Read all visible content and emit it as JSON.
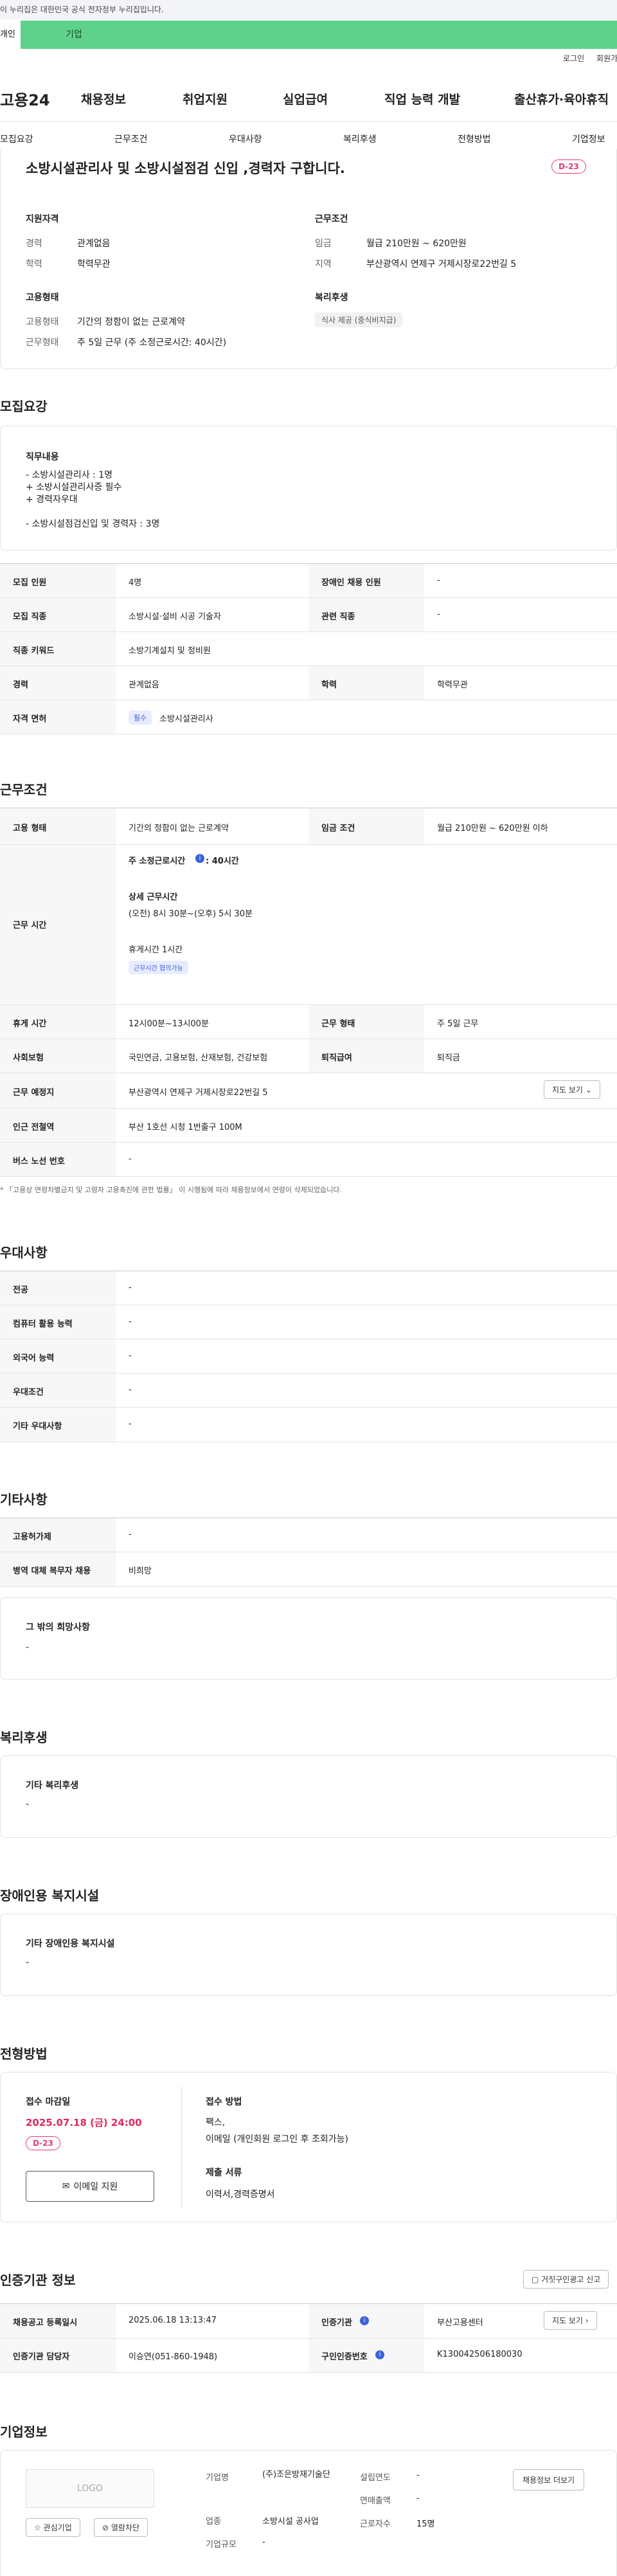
{
  "gov_banner": "이 누리집은 대한민국 공식 전자정부 누리집입니다.",
  "user_tabs": {
    "person": "개인",
    "corp": "기업"
  },
  "util": {
    "login": "로그인",
    "join": "회원가입"
  },
  "gnb": {
    "logo": "고용24",
    "menus": [
      "채용정보",
      "취업지원",
      "실업급여",
      "직업 능력 개발",
      "출산휴가·육아휴직"
    ]
  },
  "snb": [
    "모집요강",
    "근무조건",
    "우대사항",
    "복리후생",
    "전형방법",
    "기업정보"
  ],
  "summary": {
    "title": "소방시설관리사 및 소방시설점검 신입 ,경력자 구합니다.",
    "dday": "D-23",
    "qual_title": "지원자격",
    "qual": [
      {
        "k": "경력",
        "v": "관계없음"
      },
      {
        "k": "학력",
        "v": "학력무관"
      }
    ],
    "cond_title": "근무조건",
    "cond": [
      {
        "k": "임금",
        "v": "월급 210만원 ~ 620만원"
      },
      {
        "k": "지역",
        "v": "부산광역시 연제구 거제시장로22번길 5"
      }
    ],
    "emp_title": "고용형태",
    "emp": [
      {
        "k": "고용형태",
        "v": "기간의 정함이 없는 근로계약"
      },
      {
        "k": "근무형태",
        "v": "주 5일 근무 (주 소정근로시간: 40시간)"
      }
    ],
    "welfare_title": "복리후생",
    "welfare_chip": "식사 제공 (중식비지급)"
  },
  "recruit": {
    "title": "모집요강",
    "duty_title": "직무내용",
    "duty_lines": [
      "- 소방시설관리사 : 1명",
      "+ 소방시설관리사증 필수",
      "+ 경력자우대",
      "",
      "- 소방시설점검신입 및 경력자 : 3명"
    ],
    "rows": [
      {
        "k1": "모집 인원",
        "v1": "4명",
        "k2": "장애인 채용 인원",
        "v2": "-"
      },
      {
        "k1": "모집 직종",
        "v1": "소방시설·설비 시공 기술자",
        "k2": "관련 직종",
        "v2": "-"
      },
      {
        "k1": "직종 키워드",
        "v1": "소방기계설치 및 정비원"
      },
      {
        "k1": "경력",
        "v1": "관계없음",
        "k2": "학력",
        "v2": "학력무관"
      },
      {
        "k1": "자격 면허",
        "chip": "필수",
        "v1": "소방시설관리사"
      }
    ]
  },
  "work": {
    "title": "근무조건",
    "emp_type_k": "고용 형태",
    "emp_type_v": "기간의 정함이 없는 근로계약",
    "wage_k": "임금 조건",
    "wage_v": "월급 210만원 ~ 620만원 이하",
    "hours_k": "근무 시간",
    "hours_main": "주 소정근로시간",
    "hours_main_v": ": 40시간",
    "hours_detail_title": "상세 근무시간",
    "hours_detail": "(오전) 8시 30분~(오후) 5시 30분",
    "rest": "휴게시간 1시간",
    "rest_chip": "근무시간 협의가능",
    "rows": [
      {
        "k1": "휴게 시간",
        "v1": "12시00분~13시00분",
        "k2": "근무 형태",
        "v2": "주 5일 근무"
      },
      {
        "k1": "사회보험",
        "v1": "국민연금, 고용보험, 산재보험, 건강보험",
        "k2": "퇴직급여",
        "v2": "퇴직금"
      }
    ],
    "location_k": "근무 예정지",
    "location_v": "부산광역시 연제구 거제시장로22번길 5",
    "map_btn": "지도 보기",
    "subway_k": "인근 전철역",
    "subway_v": "부산 1호선 시청 1번출구 100M",
    "bus_k": "버스 노선 번호",
    "bus_v": "-",
    "note": "* 「고용상 연령차별금지 및 고령자 고용촉진에 관한 법률」 이 시행됨에 따라 채용정보에서 연령이 삭제되었습니다."
  },
  "prefer": {
    "title": "우대사항",
    "rows": [
      {
        "k": "전공",
        "v": "-"
      },
      {
        "k": "컴퓨터 활용 능력",
        "v": "-"
      },
      {
        "k": "외국어 능력",
        "v": "-"
      },
      {
        "k": "우대조건",
        "v": "-"
      },
      {
        "k": "기타 우대사항",
        "v": "-"
      }
    ]
  },
  "etc": {
    "title": "기타사항",
    "rows": [
      {
        "k": "고용허가제",
        "v": "-"
      },
      {
        "k": "병역 대체 복무자 채용",
        "v": "비희망"
      }
    ],
    "other_title": "그 밖의 희망사항",
    "other_v": "-"
  },
  "welfare": {
    "title": "복리후생",
    "sub": "기타 복리후생",
    "v": "-"
  },
  "disabled": {
    "title": "장애인용 복지시설",
    "sub": "기타 장애인용 복지시설",
    "v": "-"
  },
  "apply": {
    "title": "전형방법",
    "deadline_k": "접수 마감일",
    "deadline_v": "2025.07.18 (금) 24:00",
    "dday": "D-23",
    "email_btn": "이메일 지원",
    "method_k": "접수 방법",
    "method_v1": "팩스,",
    "method_v2": "이메일 (개인회원 로그인 후 조회가능)",
    "docs_k": "제출 서류",
    "docs_v": "이력서,경력증명서"
  },
  "agency": {
    "title": "인증기관 정보",
    "report_btn": "거짓구인광고 신고",
    "rows": [
      {
        "k1": "채용공고 등록일시",
        "v1": "2025.06.18 13:13:47",
        "k2": "인증기관",
        "v2": "부산고용센터"
      },
      {
        "k1": "인증기관 담당자",
        "v1": "이승연(051-860-1948)",
        "k2": "구인인증번호",
        "v2": "K130042506180030"
      }
    ],
    "map_btn": "지도 보기"
  },
  "company": {
    "title": "기업정보",
    "logo": "LOGO",
    "fav_btn": "관심기업",
    "block_btn": "열람차단",
    "name_k": "기업명",
    "name_v": "(주)조은방재기술단",
    "industry_k": "업종",
    "industry_v": "소방시설 공사업",
    "scale_k": "기업규모",
    "scale_v": "-",
    "founded_k": "설립연도",
    "founded_v": "-",
    "sales_k": "연매출액",
    "sales_v": "-",
    "staff_k": "근로자수",
    "staff_v": "15명",
    "jobs_btn": "채용정보 더보기"
  }
}
